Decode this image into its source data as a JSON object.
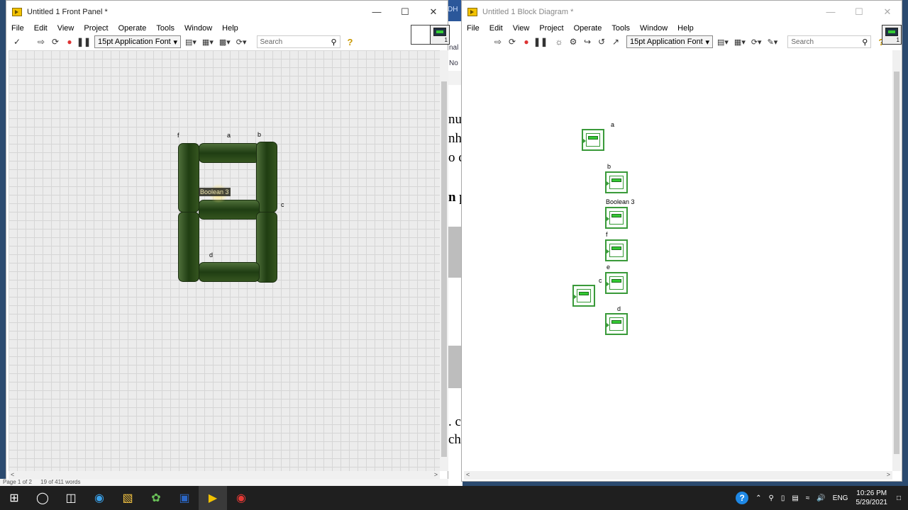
{
  "front_panel": {
    "title": "Untitled 1 Front Panel *",
    "menu": [
      "File",
      "Edit",
      "View",
      "Project",
      "Operate",
      "Tools",
      "Window",
      "Help"
    ],
    "font": "15pt Application Font",
    "search_placeholder": "Search",
    "segment_labels": {
      "a": "a",
      "b": "b",
      "c": "c",
      "d": "d",
      "f": "f"
    },
    "tooltip": "Boolean 3",
    "icon_number": "1"
  },
  "block_diagram": {
    "title": "Untitled 1 Block Diagram *",
    "menu": [
      "File",
      "Edit",
      "View",
      "Project",
      "Operate",
      "Tools",
      "Window",
      "Help"
    ],
    "font": "15pt Application Font",
    "search_placeholder": "Search",
    "terminals": [
      "a",
      "b",
      "Boolean 3",
      "f",
      "e",
      "c",
      "d"
    ],
    "icon_number": "1"
  },
  "background_doc": {
    "fragments": [
      "nu",
      "nh",
      "o c",
      "n p",
      ". c",
      "ch"
    ],
    "top_text": "DH",
    "small1": "nal",
    "small2": "No"
  },
  "status_bar": {
    "page": "Page 1 of 2",
    "words": "19 of 411 words"
  },
  "taskbar": {
    "language": "ENG",
    "time": "10:26 PM",
    "date": "5/29/2021"
  },
  "colors": {
    "segment_green": "#2a4a1a",
    "terminal_green": "#3a9a3a",
    "taskbar": "#1f1f1f"
  }
}
